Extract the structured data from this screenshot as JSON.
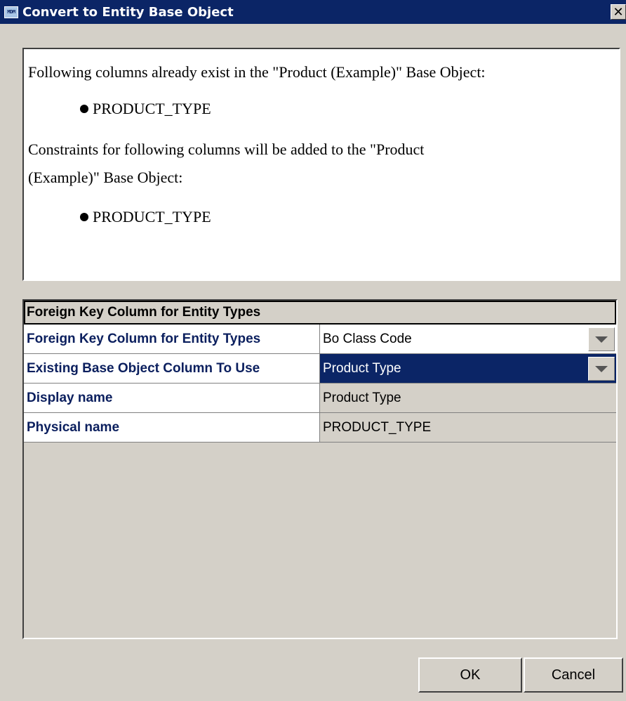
{
  "window": {
    "title": "Convert to Entity Base Object",
    "app_icon_text": "MDM",
    "close_glyph": "✕"
  },
  "message": {
    "line1": "Following columns already exist in the \"Product (Example)\" Base Object:",
    "existing_columns": [
      "PRODUCT_TYPE"
    ],
    "line2a": "Constraints for following columns will be added to the \"Product",
    "line2b": "(Example)\" Base Object:",
    "constraint_columns": [
      "PRODUCT_TYPE"
    ]
  },
  "grid": {
    "header": "Foreign Key Column for Entity Types",
    "rows": [
      {
        "label": "Foreign Key Column for Entity Types",
        "value": "Bo Class Code"
      },
      {
        "label": "Existing Base Object Column To Use",
        "value": "Product Type"
      },
      {
        "label": "Display name",
        "value": "Product Type"
      },
      {
        "label": "Physical name",
        "value": "PRODUCT_TYPE"
      }
    ]
  },
  "buttons": {
    "ok": "OK",
    "cancel": "Cancel"
  },
  "icons": {
    "dropdown": "chevron-down-icon",
    "bullet": "bullet-icon"
  }
}
